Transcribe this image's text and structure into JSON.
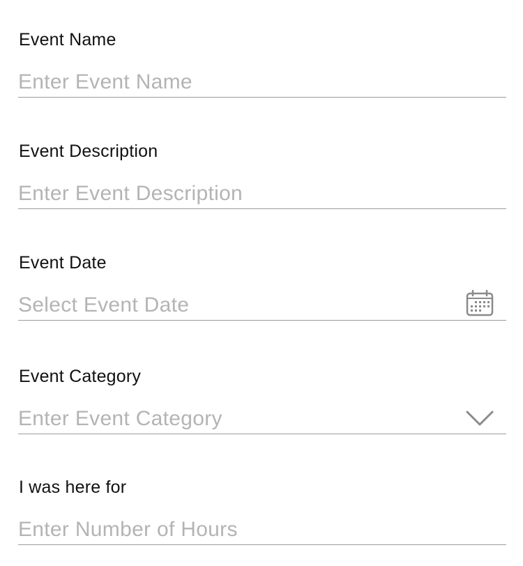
{
  "form": {
    "fields": [
      {
        "label": "Event Name",
        "placeholder": "Enter Event Name",
        "value": ""
      },
      {
        "label": "Event Description",
        "placeholder": "Enter Event Description",
        "value": ""
      },
      {
        "label": "Event Date",
        "placeholder": "Select Event Date",
        "value": "",
        "icon": "calendar-icon"
      },
      {
        "label": "Event Category",
        "placeholder": "Enter Event Category",
        "value": "",
        "icon": "chevron-down-icon"
      },
      {
        "label": "I was here for",
        "placeholder": "Enter Number of Hours",
        "value": ""
      }
    ]
  },
  "colors": {
    "label": "#111111",
    "placeholder": "#b4b4b4",
    "underline": "#9a9a9a",
    "icon": "#8a8a8a"
  }
}
